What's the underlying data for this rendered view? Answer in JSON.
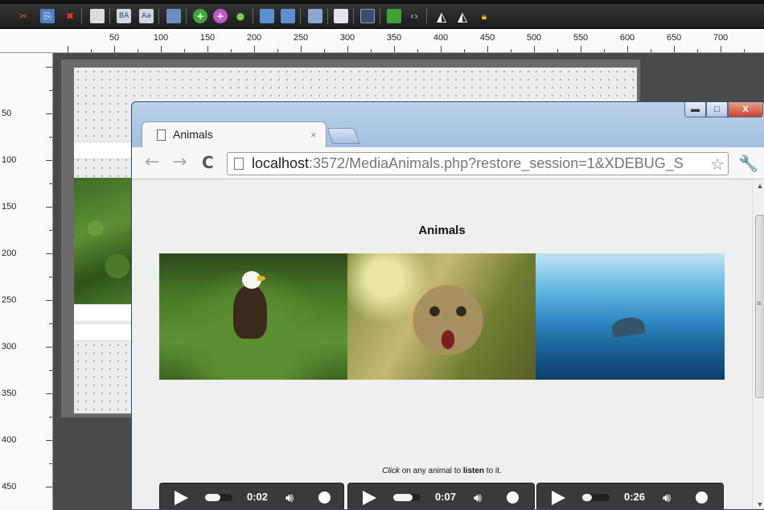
{
  "browser": {
    "tab_title": "Animals",
    "tab_close": "×",
    "url_host": "localhost",
    "url_rest": ":3572/MediaAnimals.php?restore_session=1&XDEBUG_S",
    "nav_back": "←",
    "nav_forward": "→",
    "nav_reload": "C",
    "star": "☆",
    "wrench": "🔧",
    "window_min": "▬",
    "window_max": "□",
    "window_close": "X"
  },
  "page": {
    "title": "Animals",
    "caption": {
      "click": "Click",
      "middle": " on any animal to ",
      "listen": "listen",
      "end": " to it."
    },
    "images": [
      "eagle",
      "cat",
      "whale"
    ],
    "players": [
      {
        "time": "0:02",
        "progress": 0.55
      },
      {
        "time": "0:07",
        "progress": 0.7
      },
      {
        "time": "0:26",
        "progress": 0.35
      }
    ]
  },
  "ruler": {
    "horizontal": [
      "50",
      "100",
      "150",
      "200",
      "250",
      "300",
      "350",
      "400",
      "450",
      "500",
      "550",
      "600",
      "650",
      "700"
    ],
    "vertical": [
      "50",
      "100",
      "150",
      "200",
      "250",
      "300",
      "350",
      "400",
      "450"
    ]
  },
  "scrollbar_grip": "≡"
}
